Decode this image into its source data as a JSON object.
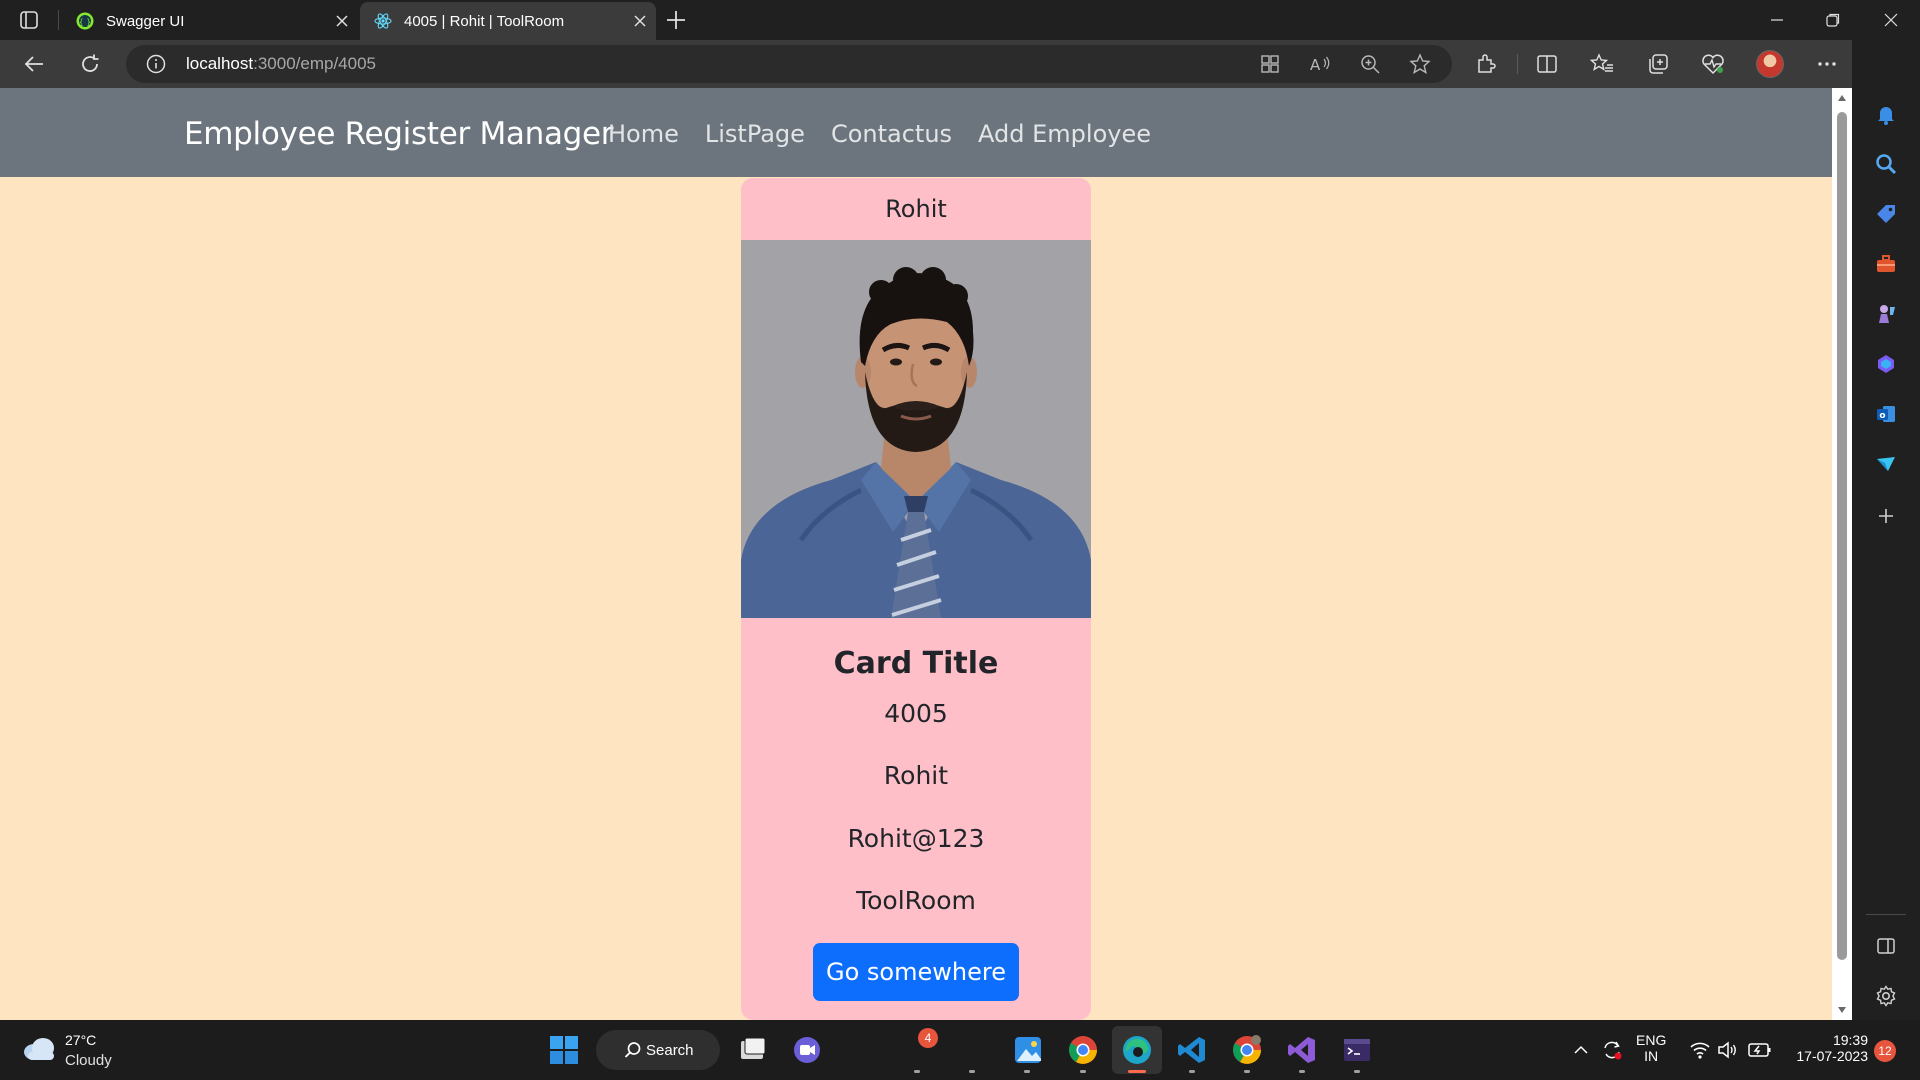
{
  "browser": {
    "tabs": [
      {
        "title": "Swagger UI",
        "favicon": "swagger-icon",
        "active": false
      },
      {
        "title": "4005 | Rohit | ToolRoom",
        "favicon": "react-icon",
        "active": true
      }
    ],
    "address": {
      "host": "localhost",
      "path": ":3000/emp/4005"
    }
  },
  "navbar": {
    "brand": "Employee Register Manager",
    "links": [
      "Home",
      "ListPage",
      "Contactus",
      "Add Employee"
    ]
  },
  "card": {
    "header": "Rohit",
    "title": "Card Title",
    "id": "4005",
    "name": "Rohit",
    "password": "Rohit@123",
    "department": "ToolRoom",
    "button": "Go somewhere"
  },
  "colors": {
    "page_bg": "#ffe4c2",
    "navbar_bg": "#6c757d",
    "card_bg": "#ffbfc9",
    "button_bg": "#0d6efd"
  },
  "taskbar": {
    "weather": {
      "temp": "27°C",
      "desc": "Cloudy"
    },
    "search_label": "Search",
    "app_badge": "4",
    "lang": {
      "line1": "ENG",
      "line2": "IN"
    },
    "time": "19:39",
    "date": "17-07-2023",
    "notifications": "12"
  }
}
